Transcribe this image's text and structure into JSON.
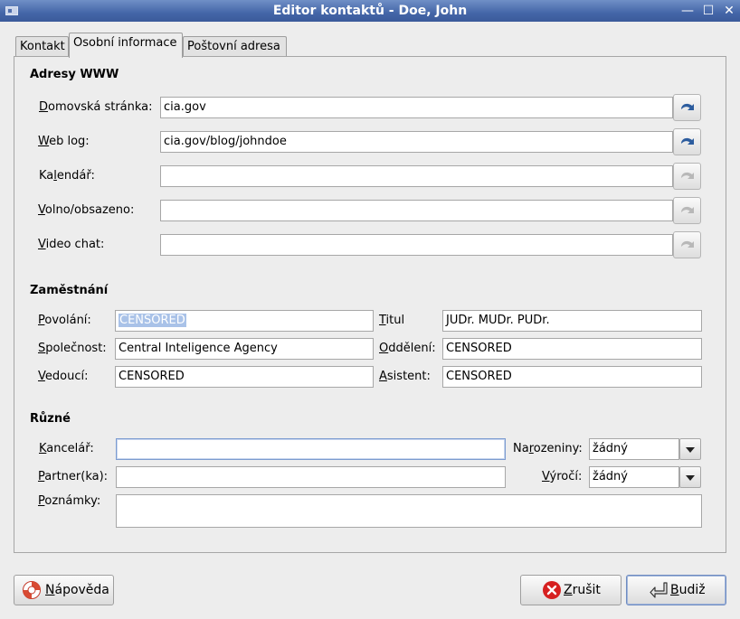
{
  "window": {
    "title": "Editor kontaktů - Doe, John",
    "minimize_glyph": "—",
    "maximize_glyph": "☐",
    "close_glyph": "✕"
  },
  "tabs": [
    {
      "label": "Kontakt",
      "active": false
    },
    {
      "label": "Osobní informace",
      "active": true
    },
    {
      "label": "Poštovní adresa",
      "active": false
    }
  ],
  "web": {
    "title": "Adresy WWW",
    "rows": [
      {
        "label_key": "D",
        "label_rest": "omovská stránka:",
        "value": "cia.gov",
        "jump_enabled": true
      },
      {
        "label_key": "W",
        "label_rest": "eb log:",
        "value": "cia.gov/blog/johndoe",
        "jump_enabled": true
      },
      {
        "label_pre": "Ka",
        "label_key": "l",
        "label_rest": "endář:",
        "value": "",
        "jump_enabled": false
      },
      {
        "label_key": "V",
        "label_rest": "olno/obsazeno:",
        "value": "",
        "jump_enabled": false
      },
      {
        "label_key": "V",
        "label_rest": "ideo chat:",
        "value": "",
        "jump_enabled": false
      }
    ]
  },
  "job": {
    "title": "Zaměstnání",
    "profession": {
      "label_key": "P",
      "label_rest": "ovolání:",
      "value": "CENSORED"
    },
    "company": {
      "label_key": "S",
      "label_rest": "polečnost:",
      "value": "Central Inteligence Agency"
    },
    "manager": {
      "label_key": "V",
      "label_rest": "edoucí:",
      "value": "CENSORED"
    },
    "titul": {
      "label_key": "T",
      "label_rest": "itul",
      "value": "JUDr. MUDr. PUDr."
    },
    "department": {
      "label_key": "O",
      "label_rest": "ddělení:",
      "value": "CENSORED"
    },
    "assistant": {
      "label_key": "A",
      "label_rest": "sistent:",
      "value": "CENSORED"
    }
  },
  "misc": {
    "title": "Různé",
    "office": {
      "label_key": "K",
      "label_rest": "ancelář:",
      "value": ""
    },
    "partner": {
      "label_key": "P",
      "label_rest": "artner(ka):",
      "value": ""
    },
    "notes": {
      "label_key": "P",
      "label_rest": "oznámky:",
      "value": ""
    },
    "birthday": {
      "label_pre": "Na",
      "label_key": "r",
      "label_rest": "ozeniny:",
      "value": "žádný"
    },
    "anniversary": {
      "label_key": "V",
      "label_rest": "ýročí:",
      "value": "žádný"
    }
  },
  "buttons": {
    "help": {
      "label_key": "N",
      "label_rest": "ápověda"
    },
    "cancel": {
      "label_key": "Z",
      "label_rest": "rušit"
    },
    "ok": {
      "label_key": "B",
      "label_rest": "udiž"
    }
  },
  "colors": {
    "titlebar": "#4466a8",
    "jump_arrow_enabled": "#2c5c9e",
    "jump_arrow_disabled": "#b8b8b8",
    "cancel_icon": "#d62020",
    "selection": "#a9c2e8"
  }
}
